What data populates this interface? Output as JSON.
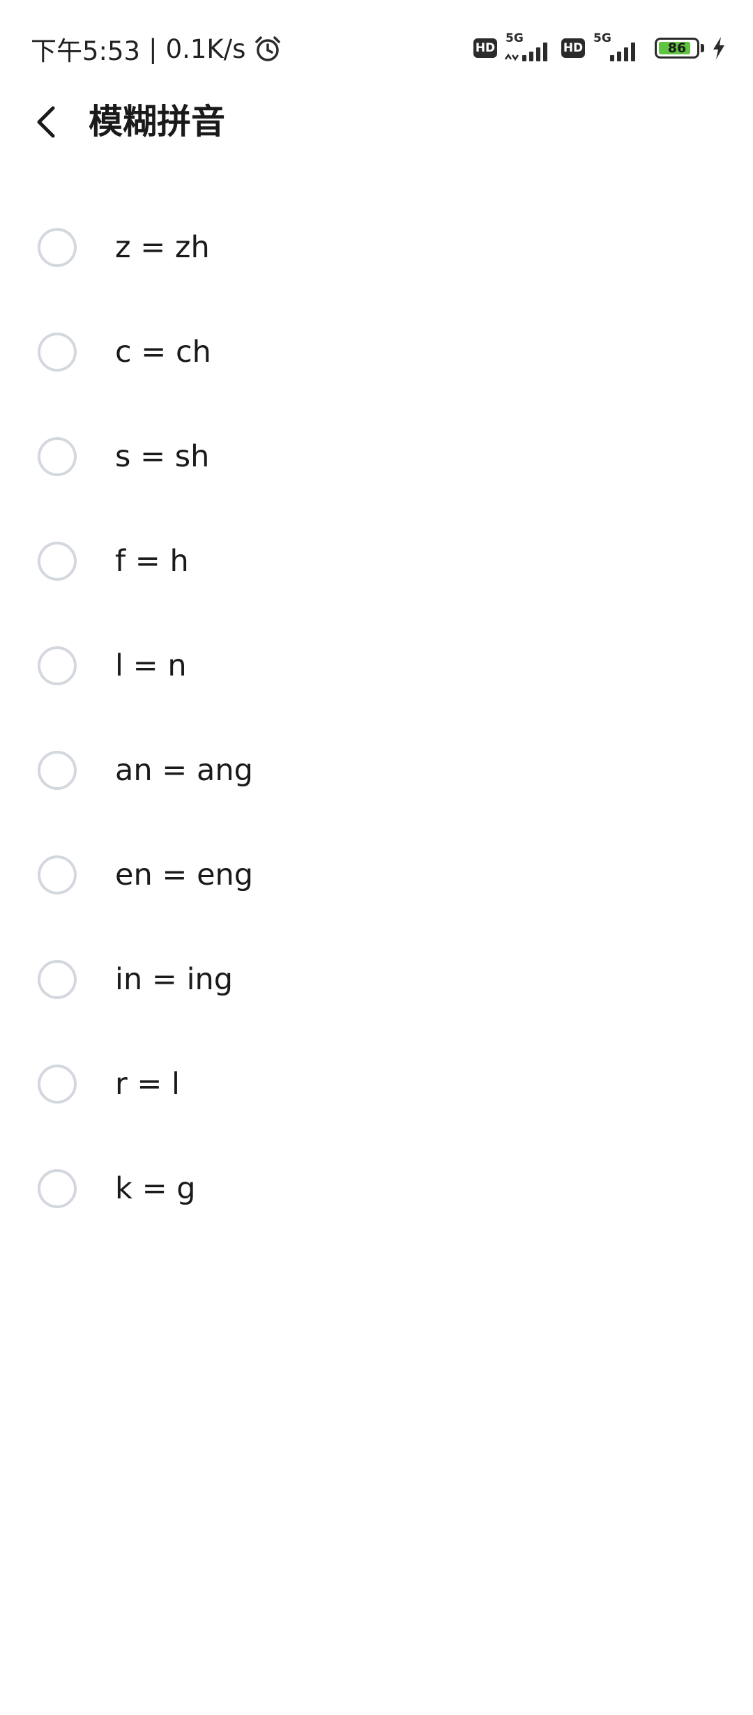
{
  "status_bar": {
    "time": "下午5:53",
    "separator": "|",
    "net_speed": "0.1K/s",
    "alarm_icon": "alarm-clock-icon",
    "hd_label_1": "HD",
    "network_1": "5G",
    "hd_label_2": "HD",
    "network_2": "5G",
    "battery_level": "86",
    "battery_fraction": 0.86,
    "battery_color": "#5ec441",
    "charging_icon": "lightning-icon"
  },
  "header": {
    "back_icon": "chevron-left-icon",
    "title": "模糊拼音"
  },
  "options": [
    {
      "label": "z = zh",
      "checked": false
    },
    {
      "label": "c = ch",
      "checked": false
    },
    {
      "label": "s = sh",
      "checked": false
    },
    {
      "label": "f = h",
      "checked": false
    },
    {
      "label": "l = n",
      "checked": false
    },
    {
      "label": "an = ang",
      "checked": false
    },
    {
      "label": "en = eng",
      "checked": false
    },
    {
      "label": "in = ing",
      "checked": false
    },
    {
      "label": "r = l",
      "checked": false
    },
    {
      "label": "k = g",
      "checked": false
    }
  ],
  "colors": {
    "radio_border": "#d3d7de",
    "text": "#1a1a1a",
    "background": "#ffffff"
  }
}
